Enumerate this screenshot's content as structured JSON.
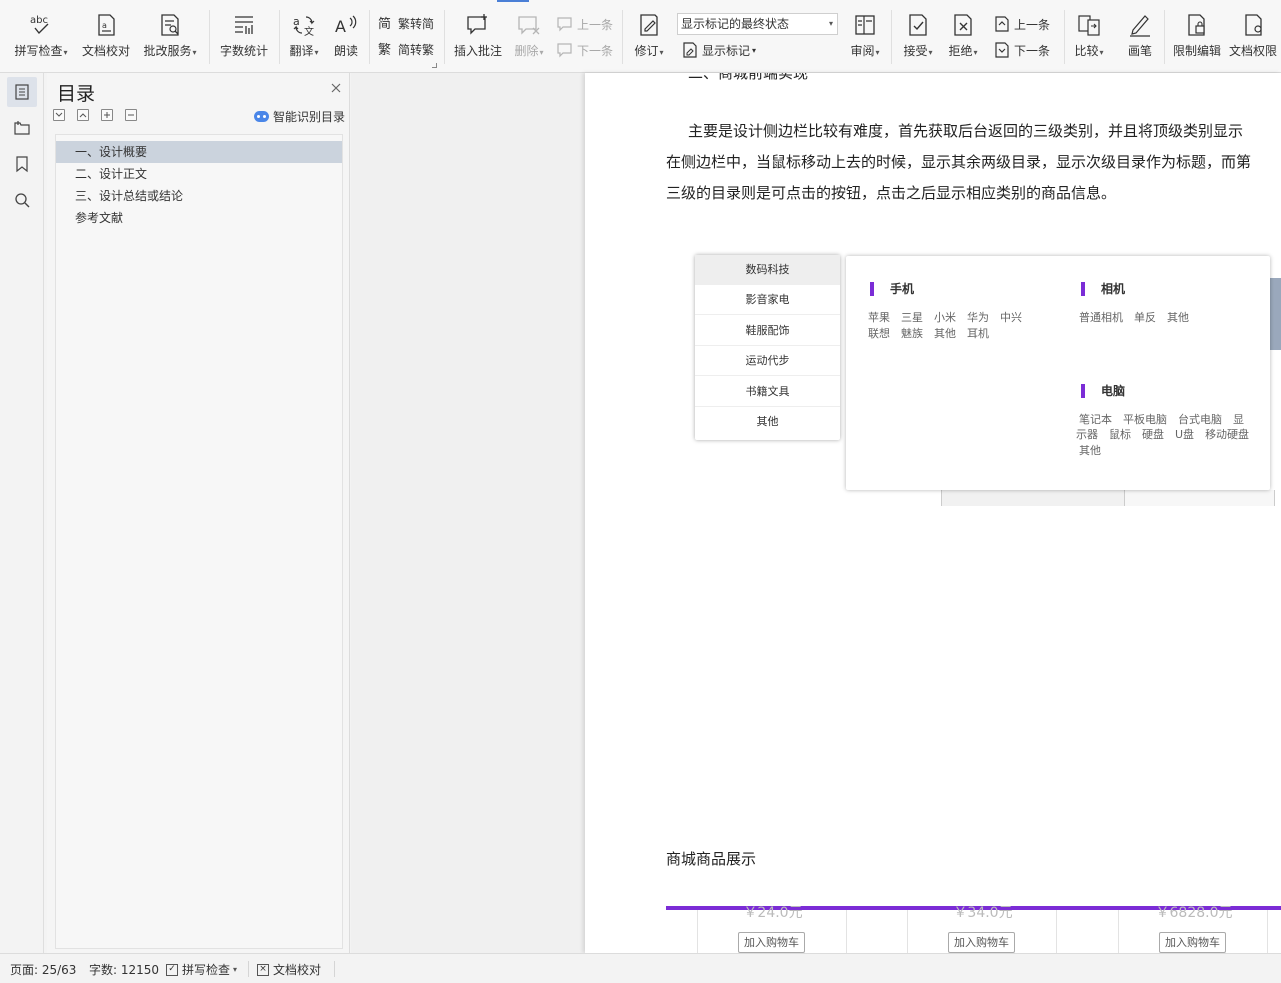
{
  "ribbon": {
    "spell_check": "拼写检查",
    "doc_proof": "文档校对",
    "review_service": "批改服务",
    "word_count": "字数统计",
    "translate": "翻译",
    "read_aloud": "朗读",
    "trad_to_simp": "繁转简",
    "simp_to_trad": "简转繁",
    "insert_comment": "插入批注",
    "delete": "删除",
    "prev_comment": "上一条",
    "next_comment": "下一条",
    "track_changes": "修订",
    "markup_state": "显示标记的最终状态",
    "show_markup": "显示标记",
    "review": "审阅",
    "accept": "接受",
    "reject": "拒绝",
    "prev_change": "上一条",
    "next_change": "下一条",
    "compare": "比较",
    "pen": "画笔",
    "restrict_edit": "限制编辑",
    "doc_permission": "文档权限",
    "spell_check_icon_text": "abc"
  },
  "toc": {
    "title": "目录",
    "smart_detect": "智能识别目录",
    "items": [
      {
        "label": "一、设计概要",
        "selected": true
      },
      {
        "label": "二、设计正文",
        "selected": false
      },
      {
        "label": "三、设计总结或结论",
        "selected": false
      },
      {
        "label": "参考文献",
        "selected": false
      }
    ]
  },
  "document": {
    "clipped_top": "二、商城前端实现",
    "paragraph_lines": [
      "主要是设计侧边栏比较有难度，首先获取后台返回的三级类别，并且将顶级类别显示",
      "在侧边栏中，当鼠标移动上去的时候，显示其余两级目录，显示次级目录作为标题，而第",
      "三级的目录则是可点击的按钮，点击之后显示相应类别的商品信息。"
    ],
    "menu": [
      "数码科技",
      "影音家电",
      "鞋服配饰",
      "运动代步",
      "书籍文具",
      "其他"
    ],
    "categories": {
      "phone": {
        "title": "手机",
        "row1": [
          "苹果",
          "三星",
          "小米",
          "华为",
          "中兴"
        ],
        "row2": [
          "联想",
          "魅族",
          "其他",
          "耳机"
        ]
      },
      "camera": {
        "title": "相机",
        "row1": [
          "普通相机",
          "单反",
          "其他"
        ]
      },
      "computer": {
        "title": "电脑",
        "row1": [
          "笔记本",
          "平板电脑",
          "台式电脑",
          "显"
        ],
        "row2": [
          "示器",
          "鼠标",
          "硬盘",
          "U盘",
          "移动硬盘"
        ],
        "row3": [
          "其他"
        ]
      }
    },
    "section_heading": "商城商品展示",
    "products": [
      {
        "price": "￥24.0元",
        "button": "加入购物车"
      },
      {
        "price": "￥34.0元",
        "button": "加入购物车"
      },
      {
        "price": "￥6828.0元",
        "button": "加入购物车"
      }
    ]
  },
  "status": {
    "page": "页面: 25/63",
    "words": "字数: 12150",
    "spell_check": "拼写检查",
    "doc_proof": "文档校对"
  }
}
